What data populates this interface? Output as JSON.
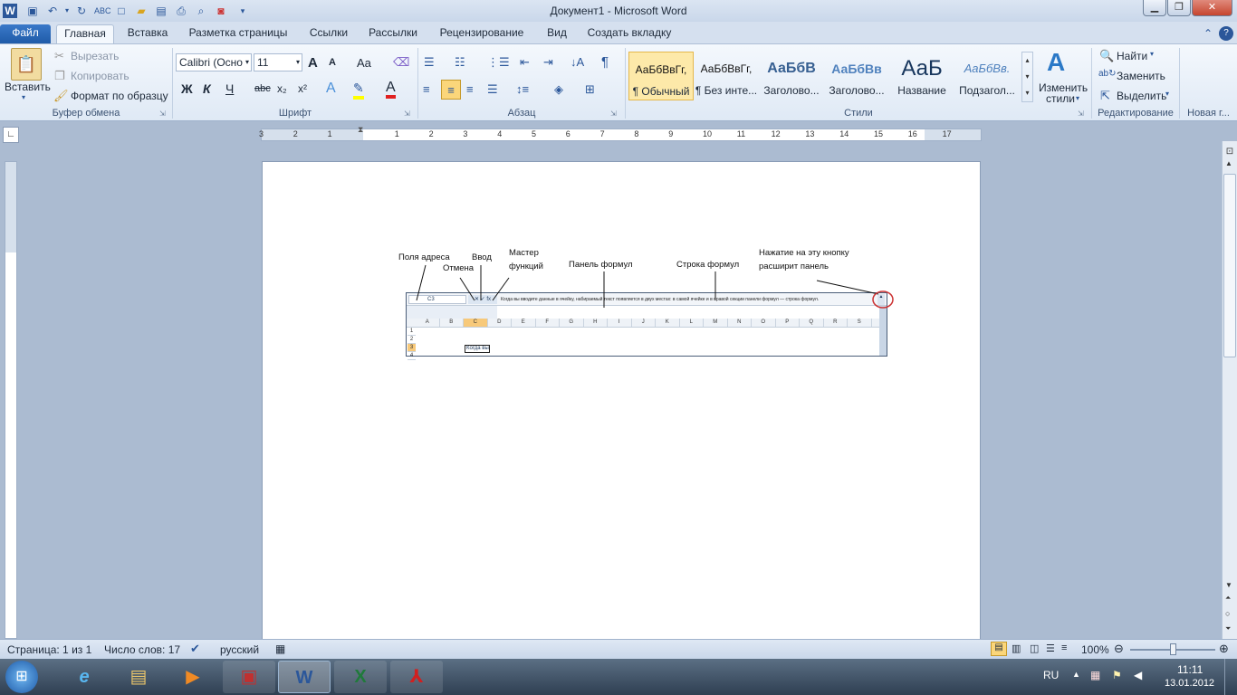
{
  "window": {
    "title": "Документ1  -  Microsoft Word"
  },
  "tabs": [
    {
      "label": "Файл"
    },
    {
      "label": "Главная"
    },
    {
      "label": "Вставка"
    },
    {
      "label": "Разметка страницы"
    },
    {
      "label": "Ссылки"
    },
    {
      "label": "Рассылки"
    },
    {
      "label": "Рецензирование"
    },
    {
      "label": "Вид"
    },
    {
      "label": "Создать вкладку"
    }
  ],
  "clipboard": {
    "paste": "Вставить",
    "cut": "Вырезать",
    "copy": "Копировать",
    "format_painter": "Формат по образцу",
    "group": "Буфер обмена"
  },
  "font": {
    "name": "Calibri (Осно",
    "size": "11",
    "group": "Шрифт",
    "bold": "Ж",
    "italic": "К",
    "underline": "Ч",
    "strike": "abc",
    "sub": "x₂",
    "sup": "x²",
    "grow": "A",
    "shrink": "A",
    "case": "Aa",
    "color": "A"
  },
  "paragraph": {
    "group": "Абзац"
  },
  "styles": {
    "group": "Стили",
    "items": [
      {
        "sample": "АаБбВвГг,",
        "name": "¶ Обычный"
      },
      {
        "sample": "АаБбВвГг,",
        "name": "¶ Без инте..."
      },
      {
        "sample": "АаБбВ",
        "name": "Заголово..."
      },
      {
        "sample": "АаБбВв",
        "name": "Заголово..."
      },
      {
        "sample": "АаБ",
        "name": "Название"
      },
      {
        "sample": "АаБбВв.",
        "name": "Подзагол..."
      }
    ],
    "change_line1": "Изменить",
    "change_line2": "стили"
  },
  "editing": {
    "find": "Найти",
    "replace": "Заменить",
    "select": "Выделить",
    "group": "Редактирование"
  },
  "newgroup": {
    "group": "Новая г..."
  },
  "ruler": {
    "numbers": [
      "3",
      "2",
      "1",
      "1",
      "2",
      "3",
      "4",
      "5",
      "6",
      "7",
      "8",
      "9",
      "10",
      "11",
      "12",
      "13",
      "14",
      "15",
      "16",
      "17"
    ]
  },
  "figure": {
    "ann_address": "Поля адреса",
    "ann_cancel": "Отмена",
    "ann_enter": "Ввод",
    "ann_wizard_1": "Мастер",
    "ann_wizard_2": "функций",
    "ann_panel": "Панель формул",
    "ann_line": "Строка формул",
    "ann_expand_1": "Нажатие на эту кнопку",
    "ann_expand_2": "расширит панель",
    "cell_ref": "C3",
    "formula_text": "Когда вы вводите данные в ячейку, набираемый текст появляется в двух местах: в самой ячейке и в правой секции панели формул — строка формул.",
    "cell_text": "Когда вы",
    "columns": [
      "A",
      "B",
      "C",
      "D",
      "E",
      "F",
      "G",
      "H",
      "I",
      "J",
      "K",
      "L",
      "M",
      "N",
      "O",
      "P",
      "Q",
      "R",
      "S"
    ],
    "rows": [
      "1",
      "2",
      "3",
      "4"
    ]
  },
  "status": {
    "page": "Страница: 1 из 1",
    "words": "Число слов: 17",
    "lang": "русский",
    "zoom": "100%"
  },
  "tray": {
    "lang": "RU",
    "time": "11:11",
    "date": "13.01.2012"
  },
  "colors": {
    "accent": "#2b579a",
    "file_tab": "#2a6ab8"
  }
}
